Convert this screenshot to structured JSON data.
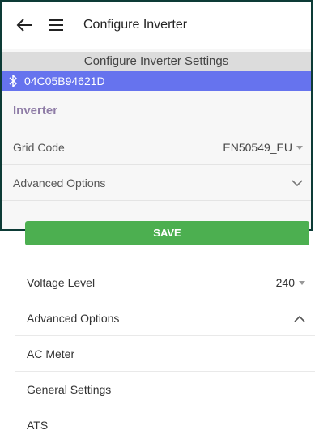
{
  "header": {
    "title": "Configure Inverter"
  },
  "subheader": {
    "title": "Configure Inverter Settings"
  },
  "bluetooth": {
    "device_id": "04C05B94621D"
  },
  "section": {
    "label": "Inverter"
  },
  "grid_code": {
    "label": "Grid Code",
    "value": "EN50549_EU"
  },
  "advanced_top": {
    "label": "Advanced Options"
  },
  "save": {
    "label": "SAVE"
  },
  "voltage": {
    "label": "Voltage Level",
    "value": "240"
  },
  "advanced_bottom": {
    "label": "Advanced Options"
  },
  "menu_items": [
    {
      "label": "AC Meter"
    },
    {
      "label": "General Settings"
    },
    {
      "label": "ATS"
    }
  ],
  "colors": {
    "accent_blue": "#6673ee",
    "save_green": "#4caf50",
    "section_purple": "#8e7ca6"
  }
}
